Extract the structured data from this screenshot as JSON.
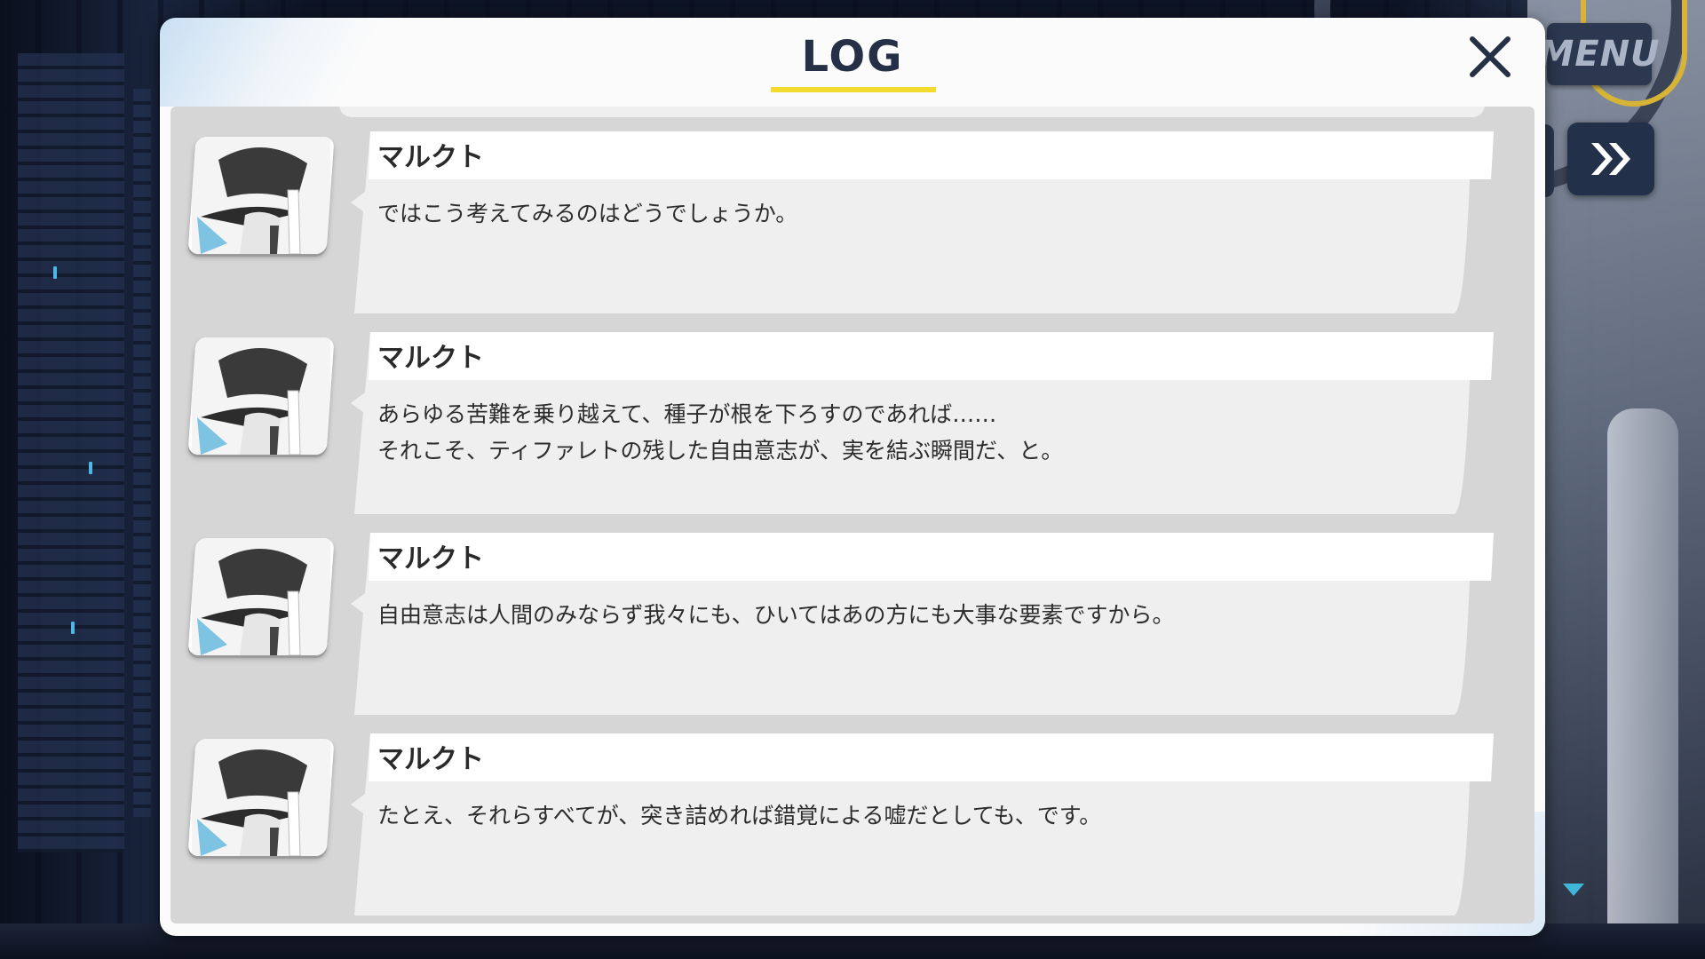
{
  "header": {
    "title": "LOG",
    "close_icon": "close-icon",
    "accent_color": "#f3da2f"
  },
  "side_controls": {
    "menu_label": "MENU",
    "fast_forward_icon": "fast-forward-icon"
  },
  "entries": [
    {
      "speaker": "マルクト",
      "text": "ではこう考えてみるのはどうでしょうか。",
      "avatar_icon": "character-portrait-icon"
    },
    {
      "speaker": "マルクト",
      "text": "あらゆる苦難を乗り越えて、種子が根を下ろすのであれば……\nそれこそ、ティファレトの残した自由意志が、実を結ぶ瞬間だ、と。",
      "avatar_icon": "character-portrait-icon"
    },
    {
      "speaker": "マルクト",
      "text": "自由意志は人間のみならず我々にも、ひいてはあの方にも大事な要素ですから。",
      "avatar_icon": "character-portrait-icon"
    },
    {
      "speaker": "マルクト",
      "text": "たとえ、それらすべてが、突き詰めれば錯覚による嘘だとしても、です。",
      "avatar_icon": "character-portrait-icon"
    }
  ]
}
